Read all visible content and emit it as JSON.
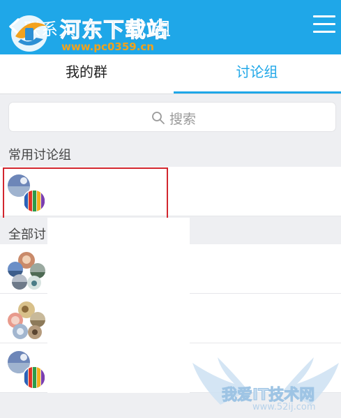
{
  "header": {
    "back_label": "联系人",
    "title": "组",
    "menu_icon": "menu-icon"
  },
  "tabs": [
    {
      "label": "我的群",
      "active": false
    },
    {
      "label": "讨论组",
      "active": true
    }
  ],
  "search": {
    "placeholder": "搜索",
    "icon": "search-icon"
  },
  "sections": {
    "frequent": {
      "title": "常用讨论组"
    },
    "all": {
      "title": "全部讨"
    }
  },
  "watermark": {
    "site_name": "河东下载站",
    "site_url": "www.pc0359.cn",
    "bottom_name": "我爱IT技术网",
    "bottom_url": "www.52ij.com"
  },
  "colors": {
    "accent": "#1fa7e8",
    "highlight": "#d2262e",
    "background": "#eeeff2"
  }
}
